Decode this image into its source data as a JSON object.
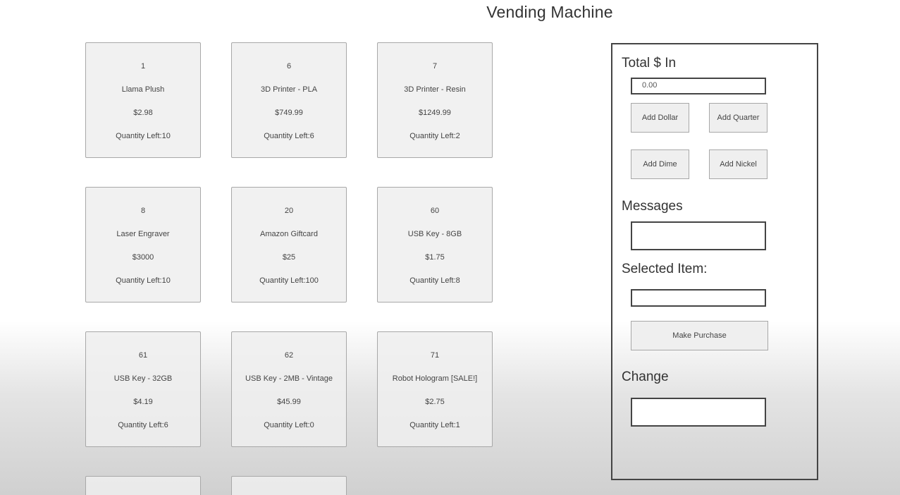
{
  "page": {
    "title": "Vending Machine"
  },
  "items": [
    {
      "id": "1",
      "name": "Llama Plush",
      "price": "$2.98",
      "quantity": "Quantity Left:10"
    },
    {
      "id": "6",
      "name": "3D Printer - PLA",
      "price": "$749.99",
      "quantity": "Quantity Left:6"
    },
    {
      "id": "7",
      "name": "3D Printer - Resin",
      "price": "$1249.99",
      "quantity": "Quantity Left:2"
    },
    {
      "id": "8",
      "name": "Laser Engraver",
      "price": "$3000",
      "quantity": "Quantity Left:10"
    },
    {
      "id": "20",
      "name": "Amazon Giftcard",
      "price": "$25",
      "quantity": "Quantity Left:100"
    },
    {
      "id": "60",
      "name": "USB Key - 8GB",
      "price": "$1.75",
      "quantity": "Quantity Left:8"
    },
    {
      "id": "61",
      "name": "USB Key - 32GB",
      "price": "$4.19",
      "quantity": "Quantity Left:6"
    },
    {
      "id": "62",
      "name": "USB Key - 2MB - Vintage",
      "price": "$45.99",
      "quantity": "Quantity Left:0"
    },
    {
      "id": "71",
      "name": "Robot Hologram [SALE!]",
      "price": "$2.75",
      "quantity": "Quantity Left:1"
    }
  ],
  "panel": {
    "total_label": "Total $ In",
    "total_value": "0.00",
    "add_dollar": "Add Dollar",
    "add_quarter": "Add Quarter",
    "add_dime": "Add Dime",
    "add_nickel": "Add Nickel",
    "messages_label": "Messages",
    "messages_value": "",
    "selected_label": "Selected Item:",
    "selected_value": "",
    "purchase_label": "Make Purchase",
    "change_label": "Change",
    "change_value": ""
  }
}
